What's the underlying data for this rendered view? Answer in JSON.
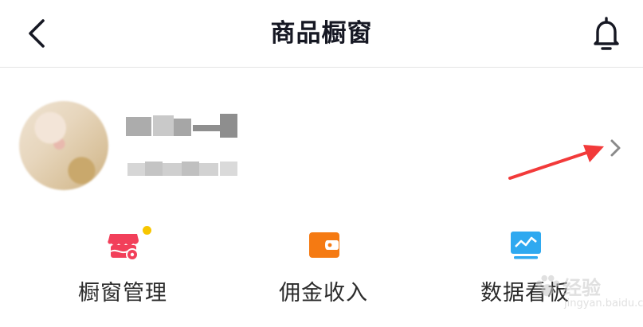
{
  "header": {
    "title": "商品橱窗",
    "back_icon": "chevron-left-icon",
    "notification_icon": "bell-icon"
  },
  "profile": {
    "avatar": "blurred-avatar",
    "name": "",
    "subtitle": "",
    "chevron_icon": "chevron-right-icon"
  },
  "menu": {
    "items": [
      {
        "label": "橱窗管理",
        "icon": "shop-settings-icon",
        "color": "#f23f5a",
        "has_dot": true
      },
      {
        "label": "佣金收入",
        "icon": "wallet-icon",
        "color": "#f57a12"
      },
      {
        "label": "数据看板",
        "icon": "chart-board-icon",
        "color": "#2fa9f0"
      }
    ],
    "dot_color": "#f7c600"
  },
  "annotation": {
    "arrow_color": "#f23a3a"
  },
  "watermark": {
    "text": "经验",
    "sub": "jingyan.baidu.com"
  }
}
